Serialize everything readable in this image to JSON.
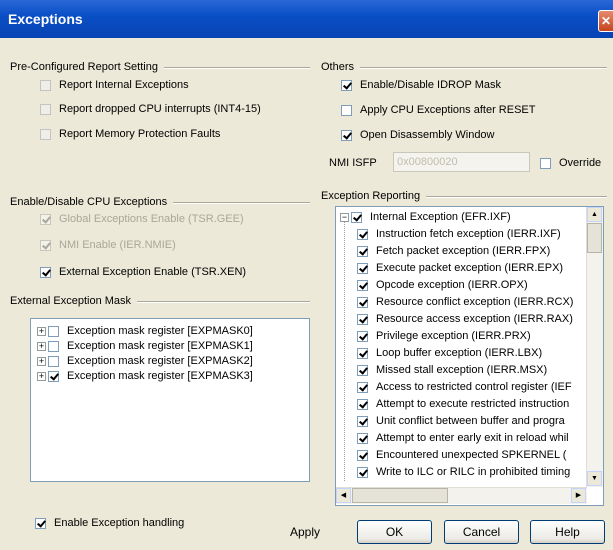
{
  "window": {
    "title": "Exceptions",
    "close_glyph": "✕"
  },
  "preconfigured": {
    "title": "Pre-Configured Report Setting",
    "items": [
      {
        "label": "Report Internal Exceptions",
        "checked": false
      },
      {
        "label": "Report dropped CPU interrupts (INT4-15)",
        "checked": false
      },
      {
        "label": "Report Memory Protection Faults",
        "checked": false
      }
    ]
  },
  "others": {
    "title": "Others",
    "items": [
      {
        "label": "Enable/Disable IDROP Mask",
        "checked": true
      },
      {
        "label": "Apply CPU Exceptions after RESET",
        "checked": false
      },
      {
        "label": "Open Disassembly Window",
        "checked": true
      }
    ],
    "nmi_label": "NMI ISFP",
    "nmi_value": "0x00800020",
    "override_label": "Override",
    "override_checked": false
  },
  "cpu_exceptions": {
    "title": "Enable/Disable CPU Exceptions",
    "items": [
      {
        "label": "Global Exceptions Enable (TSR.GEE)",
        "checked": true,
        "disabled": true
      },
      {
        "label": "NMI Enable (IER.NMIE)",
        "checked": true,
        "disabled": true
      },
      {
        "label": "External Exception Enable (TSR.XEN)",
        "checked": true,
        "disabled": false
      }
    ]
  },
  "external_mask": {
    "title": "External Exception Mask",
    "items": [
      {
        "label": "Exception mask register [EXPMASK0]",
        "checked": false
      },
      {
        "label": "Exception mask register [EXPMASK1]",
        "checked": false
      },
      {
        "label": "Exception mask register [EXPMASK2]",
        "checked": false
      },
      {
        "label": "Exception mask register [EXPMASK3]",
        "checked": true
      }
    ]
  },
  "reporting": {
    "title": "Exception Reporting",
    "root": {
      "label": "Internal Exception (EFR.IXF)",
      "checked": true
    },
    "items": [
      {
        "label": "Instruction fetch exception (IERR.IXF)",
        "checked": true
      },
      {
        "label": "Fetch packet exception (IERR.FPX)",
        "checked": true
      },
      {
        "label": "Execute packet exception (IERR.EPX)",
        "checked": true
      },
      {
        "label": "Opcode exception (IERR.OPX)",
        "checked": true
      },
      {
        "label": "Resource conflict exception (IERR.RCX)",
        "checked": true
      },
      {
        "label": "Resource access exception (IERR.RAX)",
        "checked": true
      },
      {
        "label": "Privilege exception (IERR.PRX)",
        "checked": true
      },
      {
        "label": "Loop buffer exception (IERR.LBX)",
        "checked": true
      },
      {
        "label": "Missed stall exception (IERR.MSX)",
        "checked": true
      },
      {
        "label": "Access to restricted control register (IEF",
        "checked": true
      },
      {
        "label": "Attempt to execute restricted instruction",
        "checked": true
      },
      {
        "label": "Unit conflict between buffer and progra",
        "checked": true
      },
      {
        "label": "Attempt to enter early exit in reload whil",
        "checked": true
      },
      {
        "label": "Encountered unexpected SPKERNEL (",
        "checked": true
      },
      {
        "label": "Write to ILC or RILC in prohibited timing",
        "checked": true
      }
    ]
  },
  "footer": {
    "enable_handling_label": "Enable Exception handling",
    "enable_handling_checked": true,
    "apply_label": "Apply",
    "ok_label": "OK",
    "cancel_label": "Cancel",
    "help_label": "Help"
  },
  "icons": {
    "expand": "+",
    "collapse": "−",
    "arrow_up": "▲",
    "arrow_down": "▼",
    "arrow_left": "◀",
    "arrow_right": "▶"
  }
}
